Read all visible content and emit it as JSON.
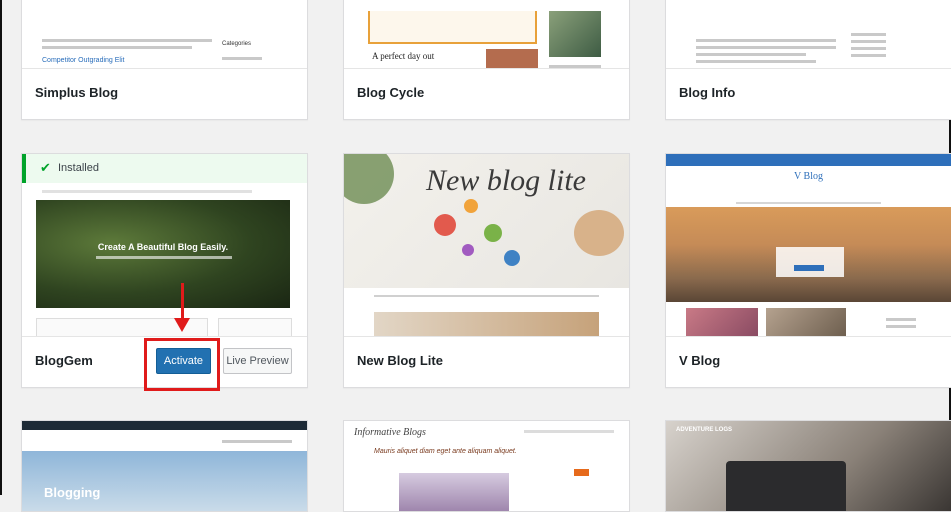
{
  "themes_row1": [
    {
      "name": "Simplus Blog",
      "preview_link": "Competitor Outgrading Elit",
      "preview_widget": "Categories"
    },
    {
      "name": "Blog Cycle",
      "preview_heading": "A perfect day out"
    },
    {
      "name": "Blog Info"
    }
  ],
  "themes_row2": [
    {
      "name": "BlogGem",
      "installed_label": "Installed",
      "hero_text": "Create A Beautiful Blog Easily.",
      "activate_label": "Activate",
      "live_preview_label": "Live Preview"
    },
    {
      "name": "New Blog Lite",
      "hero_title": "New blog lite"
    },
    {
      "name": "V Blog",
      "header_title": "V Blog"
    }
  ],
  "themes_row3": [
    {
      "hero_text": "Blogging"
    },
    {
      "header_title": "Informative Blogs",
      "tagline": "Mauris aliquet diam eget ante aliquam aliquet."
    },
    {
      "site_label": "ADVENTURE LOGS"
    }
  ],
  "annotation": {
    "color": "#e01b1b"
  }
}
